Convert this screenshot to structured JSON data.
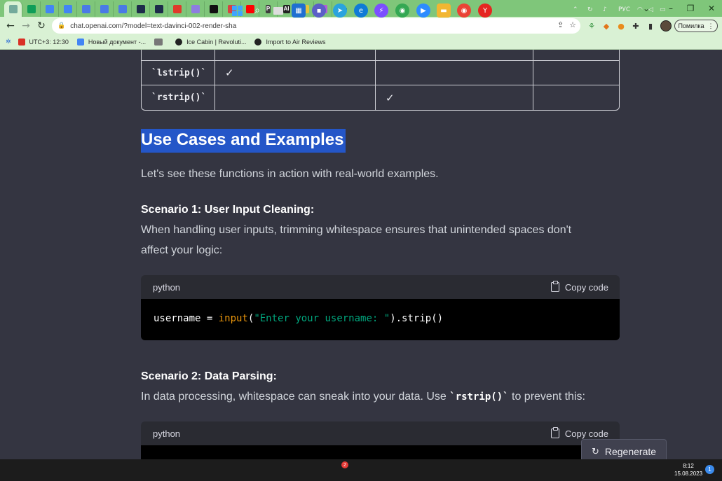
{
  "browser": {
    "tabs": [
      {
        "icon": "chatgpt-icon",
        "color": "#74aa9c",
        "active": true
      },
      {
        "icon": "sheets-plus-icon",
        "color": "#0f9d58"
      },
      {
        "icon": "docs-icon",
        "color": "#4285f4"
      },
      {
        "icon": "docs-icon",
        "color": "#4285f4"
      },
      {
        "icon": "translate-icon",
        "color": "#4a7ae6"
      },
      {
        "icon": "translate-icon",
        "color": "#4a7ae6"
      },
      {
        "icon": "translate-icon",
        "color": "#4a7ae6"
      },
      {
        "icon": "hexagon-icon",
        "color": "#1d2b4a"
      },
      {
        "icon": "hexagon-icon",
        "color": "#1d2b4a"
      },
      {
        "icon": "target-icon",
        "color": "#e0392b"
      },
      {
        "icon": "star-icon",
        "color": "#8d7de0"
      },
      {
        "icon": "bowtie-icon",
        "color": "#111111"
      },
      {
        "icon": "wave-icon",
        "color": "#d94141"
      },
      {
        "icon": "youtube-icon",
        "color": "#ff0000"
      },
      {
        "icon": "p-icon",
        "color": "#3d3d3d",
        "letter": "P"
      },
      {
        "icon": "ai-icon",
        "color": "#222222",
        "letter": "AI"
      },
      {
        "icon": "coin-icon",
        "color": "#e7c33a"
      },
      {
        "icon": "circle-icon",
        "color": "#b15fd6"
      }
    ],
    "new_tab_label": "+",
    "url": "chat.openai.com/?model=text-davinci-002-render-sha",
    "profile_label": "Помилка",
    "bookmarks": [
      {
        "label": "UTC+3: 12:30",
        "color": "#d93025"
      },
      {
        "label": "Новый документ -...",
        "color": "#4285f4"
      },
      {
        "label": "",
        "color": "#555555"
      },
      {
        "label": "Ice Cabin | Revoluti...",
        "color": "#222222"
      },
      {
        "label": "Import to Air Reviews",
        "color": "#222222"
      }
    ]
  },
  "table": {
    "rows": [
      {
        "method": "`lstrip()`",
        "c1": "✓",
        "c2": "",
        "c3": ""
      },
      {
        "method": "`rstrip()`",
        "c1": "",
        "c2": "✓",
        "c3": ""
      }
    ]
  },
  "article": {
    "heading": "Use Cases and Examples",
    "intro": "Let's see these functions in action with real-world examples.",
    "scenario1_title": "Scenario 1: User Input Cleaning:",
    "scenario1_text_line1": "When handling user inputs, trimming whitespace ensures that unintended spaces don't",
    "scenario1_text_line2": "affect your logic:",
    "code1": {
      "language": "python",
      "copy_label": "Copy code",
      "tok_var": "username = ",
      "tok_fn": "input",
      "tok_open": "(",
      "tok_str": "\"Enter your username: \"",
      "tok_rest": ").strip()"
    },
    "scenario2_title": "Scenario 2: Data Parsing:",
    "scenario2_text_before": "In data processing, whitespace can sneak into your data. Use ",
    "scenario2_code": "`rstrip()`",
    "scenario2_text_after": " to prevent this:",
    "code2": {
      "language": "python",
      "copy_label": "Copy code"
    },
    "regenerate_label": "Regenerate"
  },
  "taskbar": {
    "tray_lang": "РУС",
    "time": "8:12",
    "date": "15.08.2023",
    "notification_count": "1",
    "telegram_badge": "2"
  },
  "colors": {
    "page_bg": "#343541",
    "chrome_green": "#7fc67a",
    "highlight": "#2456c8",
    "code_fn": "#e9950c",
    "code_str": "#00a67d"
  }
}
